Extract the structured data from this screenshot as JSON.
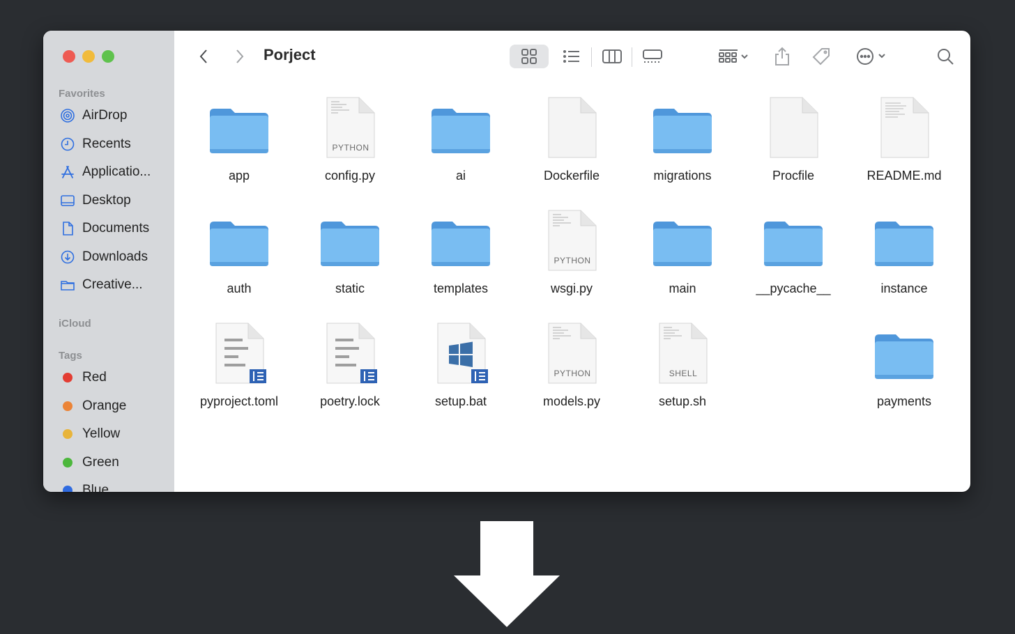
{
  "window": {
    "title": "Porject"
  },
  "sidebar": {
    "favorites_header": "Favorites",
    "favorites": [
      {
        "label": "AirDrop",
        "icon": "airdrop-icon"
      },
      {
        "label": "Recents",
        "icon": "clock-icon"
      },
      {
        "label": "Applicatio...",
        "icon": "applications-icon"
      },
      {
        "label": "Desktop",
        "icon": "desktop-icon"
      },
      {
        "label": "Documents",
        "icon": "document-icon"
      },
      {
        "label": "Downloads",
        "icon": "download-icon"
      },
      {
        "label": "Creative...",
        "icon": "folder-icon"
      }
    ],
    "icloud_header": "iCloud",
    "tags_header": "Tags",
    "tags": [
      {
        "label": "Red",
        "color": "#e33d33"
      },
      {
        "label": "Orange",
        "color": "#eb8437"
      },
      {
        "label": "Yellow",
        "color": "#e8b43a"
      },
      {
        "label": "Green",
        "color": "#4cb73c"
      },
      {
        "label": "Blue",
        "color": "#2f6be0"
      }
    ]
  },
  "files": [
    {
      "name": "app",
      "type": "folder"
    },
    {
      "name": "config.py",
      "type": "doc",
      "ext": "PYTHON"
    },
    {
      "name": "ai",
      "type": "folder"
    },
    {
      "name": "Dockerfile",
      "type": "blank"
    },
    {
      "name": "migrations",
      "type": "folder"
    },
    {
      "name": "Procfile",
      "type": "blank"
    },
    {
      "name": "README.md",
      "type": "text"
    },
    {
      "name": "auth",
      "type": "folder"
    },
    {
      "name": "static",
      "type": "folder"
    },
    {
      "name": "templates",
      "type": "folder"
    },
    {
      "name": "wsgi.py",
      "type": "doc",
      "ext": "PYTHON"
    },
    {
      "name": "main",
      "type": "folder"
    },
    {
      "name": "__pycache__",
      "type": "folder"
    },
    {
      "name": "instance",
      "type": "folder"
    },
    {
      "name": "pyproject.toml",
      "type": "lines"
    },
    {
      "name": "poetry.lock",
      "type": "lines"
    },
    {
      "name": "setup.bat",
      "type": "windows"
    },
    {
      "name": "models.py",
      "type": "doc",
      "ext": "PYTHON"
    },
    {
      "name": "setup.sh",
      "type": "doc",
      "ext": "SHELL"
    },
    {
      "name": "payments",
      "type": "folder"
    }
  ]
}
